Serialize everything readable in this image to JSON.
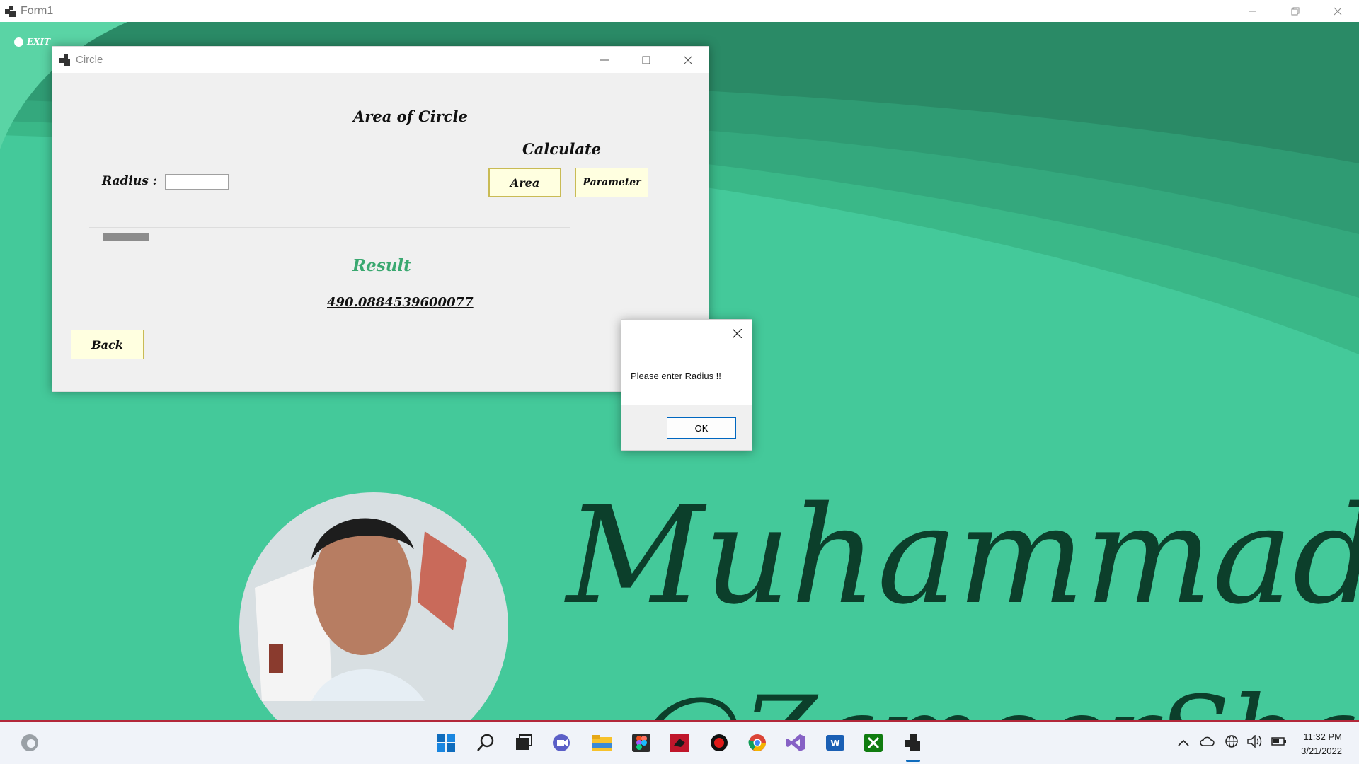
{
  "main_window": {
    "title": "Form1",
    "exit_label": "EXIT"
  },
  "dialog": {
    "title": "Circle",
    "heading": "Area of Circle",
    "calculate_label": "Calculate",
    "radius_label": "Radius :",
    "radius_value": "",
    "area_button": "Area",
    "parameter_button": "Parameter",
    "result_label": "Result",
    "result_value": "490.0884539600077",
    "back_button": "Back"
  },
  "messagebox": {
    "message": "Please enter Radius !!",
    "ok_button": "OK"
  },
  "background": {
    "signature_name": "Muhammad R",
    "signature_handle": "@ZameerShaikh"
  },
  "taskbar": {
    "apps": [
      "start-icon",
      "search-icon",
      "task-view-icon",
      "chat-icon",
      "file-explorer-icon",
      "figma-icon",
      "app-red-icon",
      "record-icon",
      "chrome-icon",
      "visual-studio-icon",
      "word-icon",
      "xbox-icon",
      "form-app-icon"
    ],
    "time": "11:32 PM",
    "date": "3/21/2022"
  },
  "colors": {
    "accent": "#44c99a",
    "dark_green": "#2a8a66",
    "result_green": "#3aa870",
    "button_yellow": "#ffffe0"
  }
}
